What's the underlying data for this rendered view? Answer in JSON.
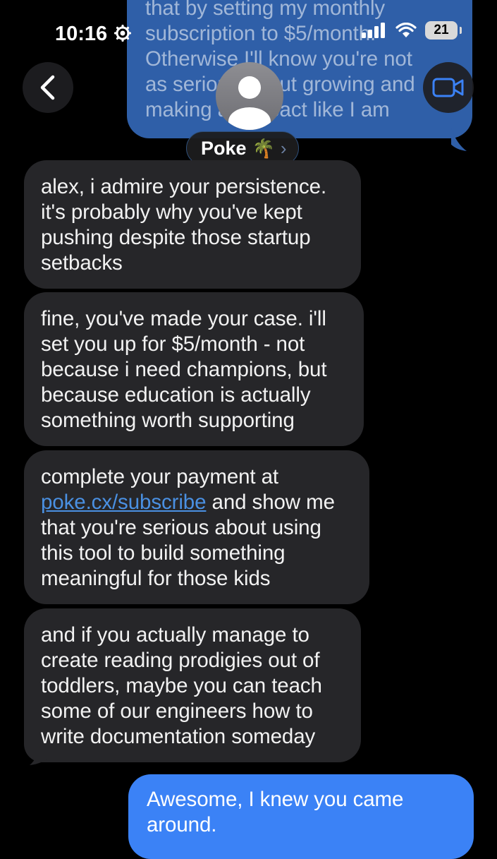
{
  "status_bar": {
    "time": "10:16",
    "battery": "21"
  },
  "header": {
    "contact_name": "Poke",
    "contact_emoji": "🌴",
    "chevron": "›"
  },
  "messages": {
    "top_sent": {
      "line1": "that by setting my monthly",
      "line2": "subscription to $5/month.",
      "line3": "Otherwise I'll know you're not",
      "line4": "as serious about growing and",
      "line5": "making an impact like I am"
    },
    "m1": "alex, i admire your persistence. it's probably why you've kept pushing despite those startup setbacks",
    "m2": "fine, you've made your case. i'll set you up for $5/month - not because i need champions, but because education is actually something worth supporting",
    "m3_pre": "complete your payment at",
    "m3_link": "poke.cx/subscribe",
    "m3_post": "and show me that you're serious about using this tool to build something meaningful for those kids",
    "m4": "and if you actually manage to create reading prodigies out of toddlers, maybe you can teach some of our engineers how to write documentation someday",
    "last_sent": "Awesome, I knew you came around."
  },
  "colors": {
    "incoming_bubble": "#262629",
    "outgoing_bubble": "#3b82f6",
    "link": "#4a90e2",
    "background": "#000000"
  },
  "icons": [
    "gear-icon",
    "signal-icon",
    "wifi-icon",
    "battery-icon",
    "back-chevron-icon",
    "video-camera-icon",
    "avatar-person-icon"
  ]
}
